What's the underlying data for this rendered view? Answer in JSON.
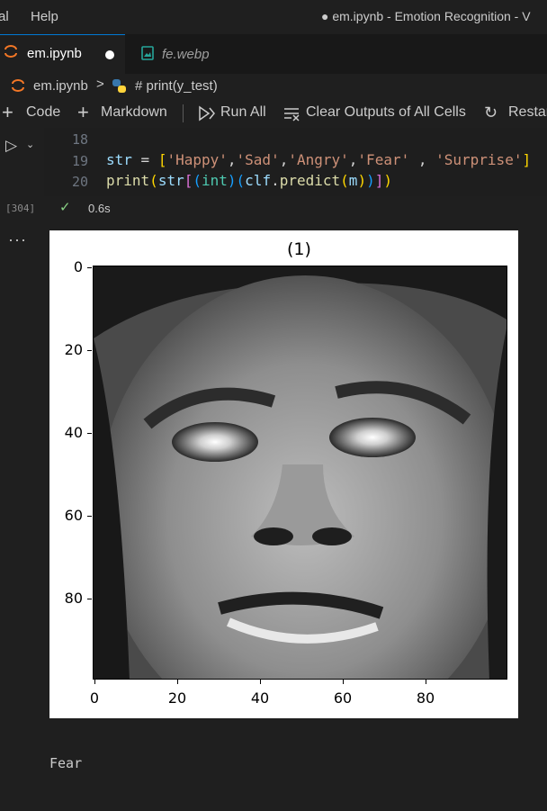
{
  "titlebar": {
    "menu_terminal": "al",
    "menu_help": "Help",
    "window_title": "● em.ipynb - Emotion Recognition - V"
  },
  "tabs": [
    {
      "label": "em.ipynb",
      "icon": "jupyter-icon",
      "dirty": true
    },
    {
      "label": "fe.webp",
      "icon": "image-file-icon"
    }
  ],
  "breadcrumb": {
    "file": "em.ipynb",
    "separator": ">",
    "cell": "# print(y_test)"
  },
  "toolbar": {
    "code": "Code",
    "markdown": "Markdown",
    "run_all": "Run All",
    "clear_outputs": "Clear Outputs of All Cells",
    "restart": "Restar"
  },
  "cell": {
    "line_numbers": [
      "18",
      "19",
      "20"
    ],
    "execution_count": "[304]",
    "duration": "0.6s",
    "status_icon": "check-icon"
  },
  "figure": {
    "title": "(1)",
    "y_ticks": [
      "0",
      "20",
      "40",
      "60",
      "80"
    ],
    "x_ticks": [
      "0",
      "20",
      "40",
      "60",
      "80"
    ]
  },
  "output": {
    "text": "Fear"
  },
  "colors": {
    "accent": "#0078d4",
    "success": "#89d185",
    "string": "#ce9178",
    "variable": "#9cdcfe"
  }
}
